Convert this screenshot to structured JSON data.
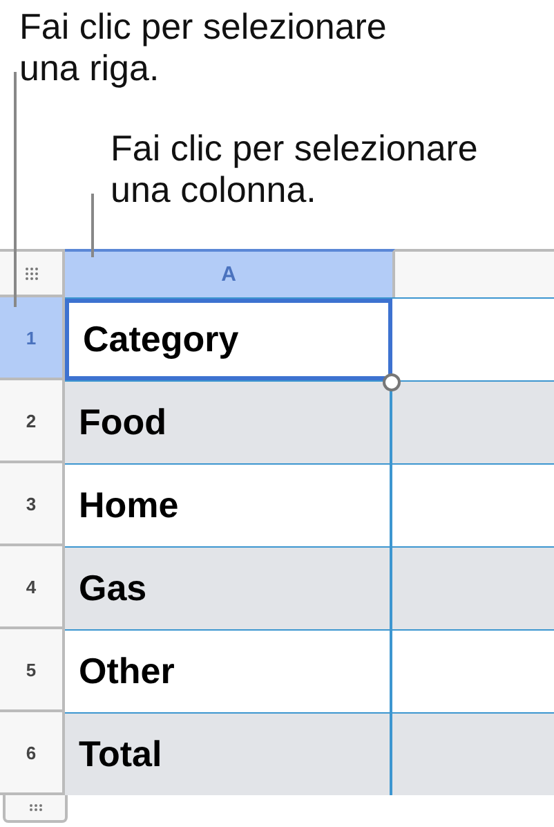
{
  "callouts": [
    {
      "text": "Fai clic per selezionare una riga."
    },
    {
      "text": "Fai clic per selezionare una colonna."
    }
  ],
  "table": {
    "columns": [
      {
        "label": "A",
        "selected": true
      }
    ],
    "rows": [
      {
        "number": "1",
        "selected": true,
        "shaded": false,
        "cells": [
          {
            "text": "Category",
            "selected": true
          }
        ]
      },
      {
        "number": "2",
        "selected": false,
        "shaded": true,
        "cells": [
          {
            "text": "Food",
            "selected": false
          }
        ]
      },
      {
        "number": "3",
        "selected": false,
        "shaded": false,
        "cells": [
          {
            "text": "Home",
            "selected": false
          }
        ]
      },
      {
        "number": "4",
        "selected": false,
        "shaded": true,
        "cells": [
          {
            "text": "Gas",
            "selected": false
          }
        ]
      },
      {
        "number": "5",
        "selected": false,
        "shaded": false,
        "cells": [
          {
            "text": "Other",
            "selected": false
          }
        ]
      },
      {
        "number": "6",
        "selected": false,
        "shaded": true,
        "cells": [
          {
            "text": "Total",
            "selected": false
          }
        ]
      }
    ]
  }
}
